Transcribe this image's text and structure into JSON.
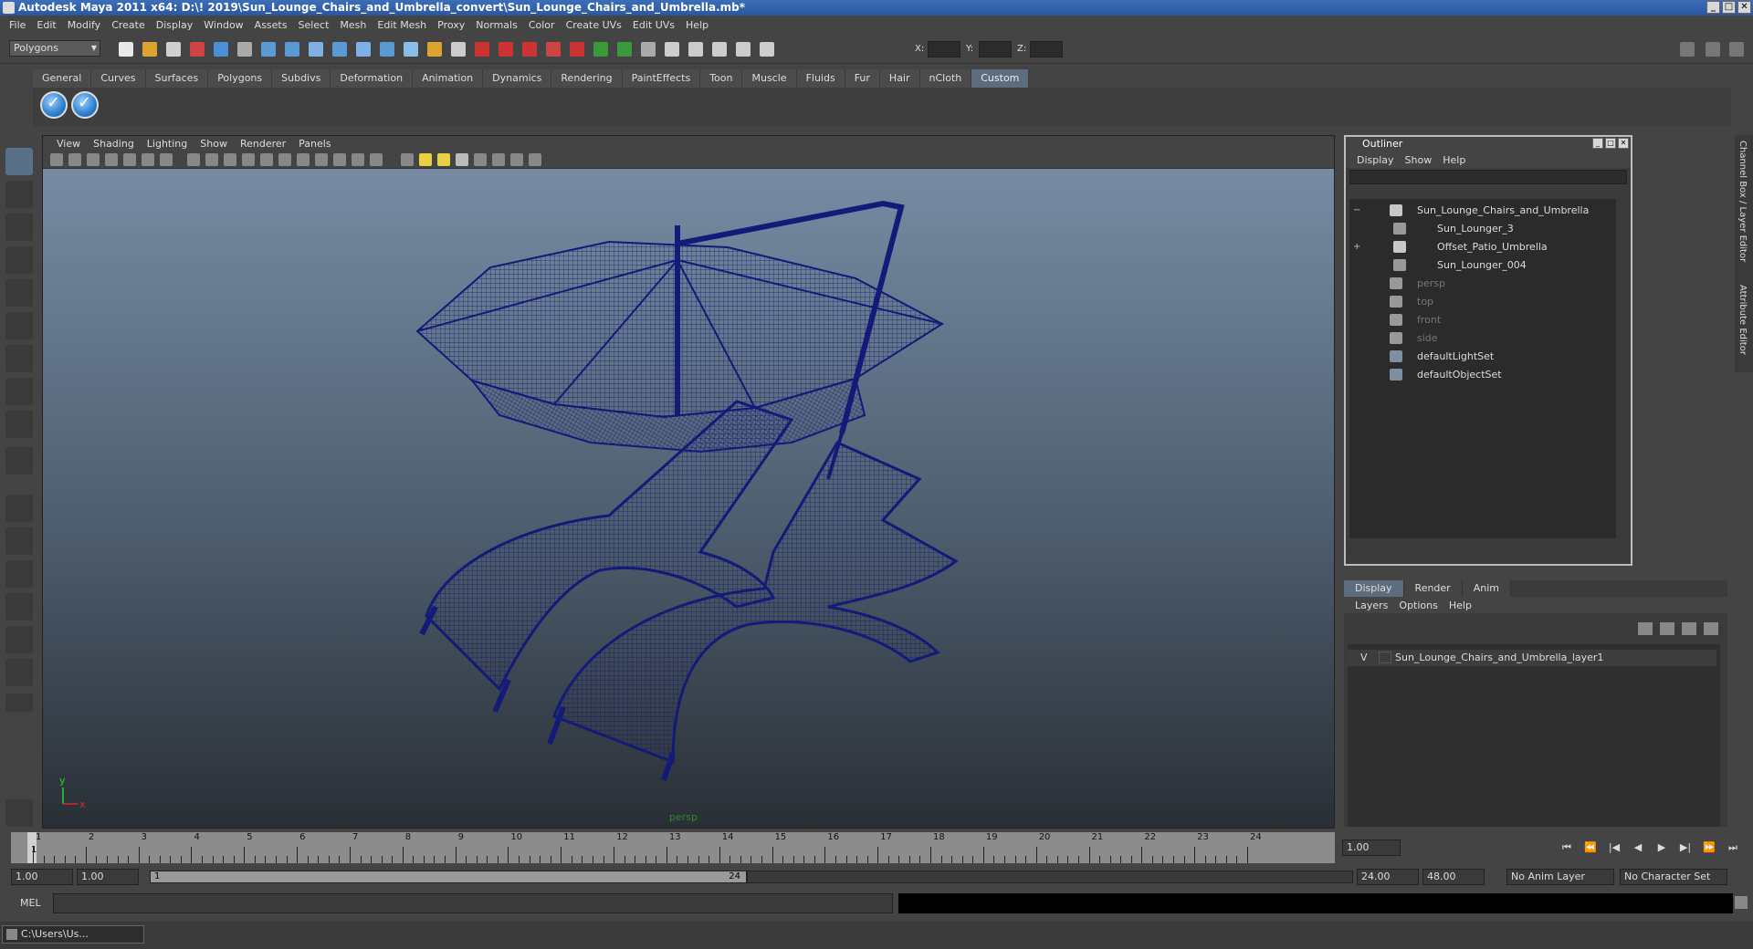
{
  "window": {
    "title": "Autodesk Maya 2011 x64: D:\\! 2019\\Sun_Lounge_Chairs_and_Umbrella_convert\\Sun_Lounge_Chairs_and_Umbrella.mb*",
    "minimize": "_",
    "maximize": "□",
    "close": "✕"
  },
  "menubar": [
    "File",
    "Edit",
    "Modify",
    "Create",
    "Display",
    "Window",
    "Assets",
    "Select",
    "Mesh",
    "Edit Mesh",
    "Proxy",
    "Normals",
    "Color",
    "Create UVs",
    "Edit UVs",
    "Help"
  ],
  "statusline": {
    "mode": "Polygons",
    "x_label": "X:",
    "y_label": "Y:",
    "z_label": "Z:"
  },
  "shelf_tabs": [
    "General",
    "Curves",
    "Surfaces",
    "Polygons",
    "Subdivs",
    "Deformation",
    "Animation",
    "Dynamics",
    "Rendering",
    "PaintEffects",
    "Toon",
    "Muscle",
    "Fluids",
    "Fur",
    "Hair",
    "nCloth",
    "Custom"
  ],
  "viewport": {
    "menu": [
      "View",
      "Shading",
      "Lighting",
      "Show",
      "Renderer",
      "Panels"
    ],
    "camera": "persp",
    "axis_y": "y",
    "axis_x": "x",
    "wire_color": "#141a78"
  },
  "outliner": {
    "title": "Outliner",
    "menu": [
      "Display",
      "Show",
      "Help"
    ],
    "items": [
      {
        "label": "Sun_Lounge_Chairs_and_Umbrella",
        "indent": 0,
        "expand": "−",
        "dim": false
      },
      {
        "label": "Sun_Lounger_3",
        "indent": 1,
        "expand": "",
        "dim": false
      },
      {
        "label": "Offset_Patio_Umbrella",
        "indent": 1,
        "expand": "+",
        "dim": false
      },
      {
        "label": "Sun_Lounger_004",
        "indent": 1,
        "expand": "",
        "dim": false
      },
      {
        "label": "persp",
        "indent": 0,
        "expand": "",
        "dim": true
      },
      {
        "label": "top",
        "indent": 0,
        "expand": "",
        "dim": true
      },
      {
        "label": "front",
        "indent": 0,
        "expand": "",
        "dim": true
      },
      {
        "label": "side",
        "indent": 0,
        "expand": "",
        "dim": true
      },
      {
        "label": "defaultLightSet",
        "indent": 0,
        "expand": "",
        "dim": false
      },
      {
        "label": "defaultObjectSet",
        "indent": 0,
        "expand": "",
        "dim": false
      }
    ]
  },
  "layers": {
    "tabs": [
      "Display",
      "Render",
      "Anim"
    ],
    "menu": [
      "Layers",
      "Options",
      "Help"
    ],
    "visibility": "V",
    "layer_name": "Sun_Lounge_Chairs_and_Umbrella_layer1"
  },
  "timeline": {
    "ticks": [
      "1",
      "2",
      "3",
      "4",
      "5",
      "6",
      "7",
      "8",
      "9",
      "10",
      "11",
      "12",
      "13",
      "14",
      "15",
      "16",
      "17",
      "18",
      "19",
      "20",
      "21",
      "22",
      "23",
      "24"
    ],
    "current_time": "1.00",
    "current_frame_label": "1"
  },
  "range": {
    "start_time": "1.00",
    "playback_start": "1.00",
    "range_start_label": "1",
    "range_end_label": "24",
    "playback_end": "24.00",
    "end_time": "48.00",
    "anim_layer": "No Anim Layer",
    "char_set": "No Character Set"
  },
  "playback": [
    "⏮",
    "⏪",
    "|◀",
    "◀",
    "▶",
    "▶|",
    "⏩",
    "⏭"
  ],
  "cmdline": {
    "label": "MEL"
  },
  "taskbar": {
    "item": "C:\\Users\\Us..."
  },
  "side_tabs": [
    "Channel Box / Layer Editor",
    "Attribute Editor"
  ]
}
